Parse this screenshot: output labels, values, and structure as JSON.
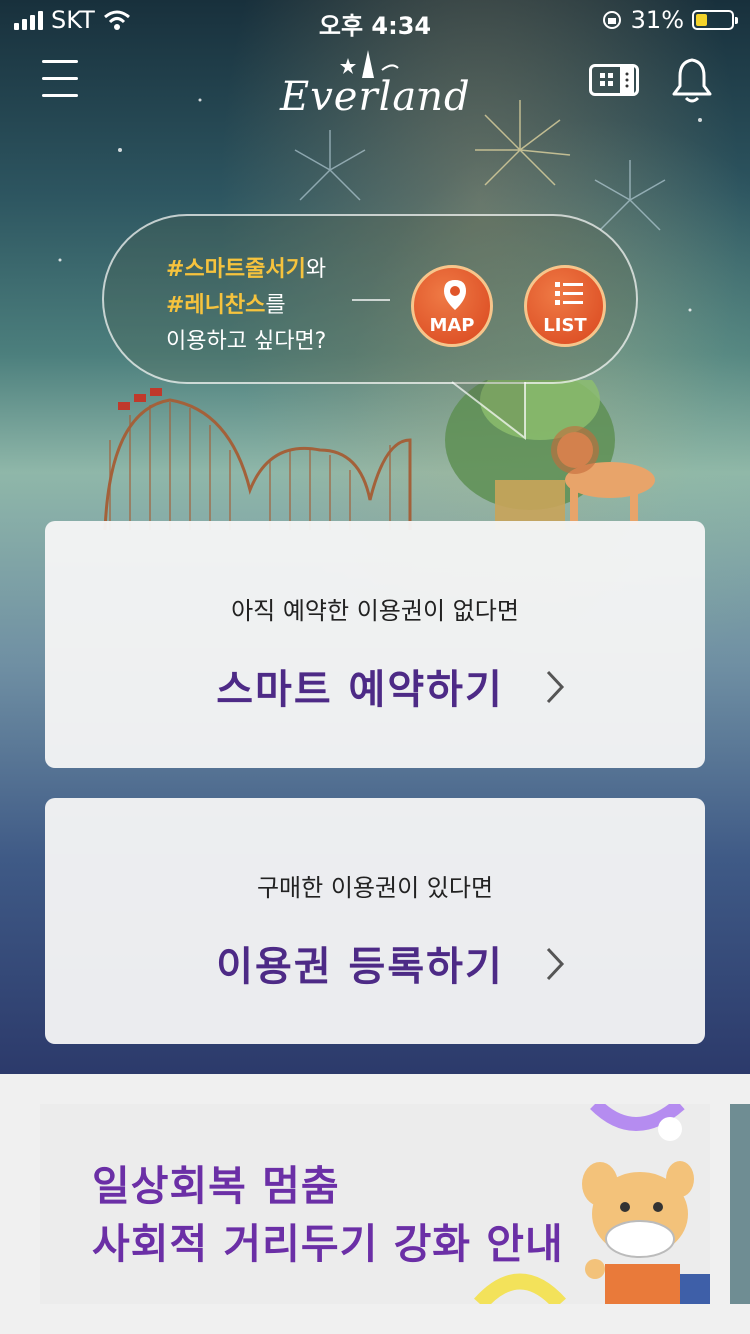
{
  "status_bar": {
    "carrier": "SKT",
    "time": "오후 4:34",
    "battery": "31%",
    "battery_level": 0.31
  },
  "header": {
    "logo_text": "Everland",
    "icons": [
      "menu-icon",
      "qr-ticket-icon",
      "bell-icon"
    ]
  },
  "promo_bubble": {
    "hashtag1": "#스마트줄서기",
    "suffix1": "와",
    "hashtag2": "#레니찬스",
    "suffix2": "를",
    "line3": "이용하고 싶다면?",
    "map_label": "MAP",
    "list_label": "LIST"
  },
  "reserve_card": {
    "subtitle": "아직 예약한 이용권이 없다면",
    "title": "스마트 예약하기"
  },
  "register_card": {
    "subtitle": "구매한 이용권이 있다면",
    "title": "이용권 등록하기"
  },
  "banner": {
    "line1": "일상회복 멈춤",
    "line2": "사회적 거리두기 강화 안내"
  },
  "colors": {
    "accent_purple": "#4d2a86",
    "hashtag_yellow": "#f6c33d",
    "button_orange": "#e0552a",
    "banner_purple": "#6b2fa6"
  }
}
